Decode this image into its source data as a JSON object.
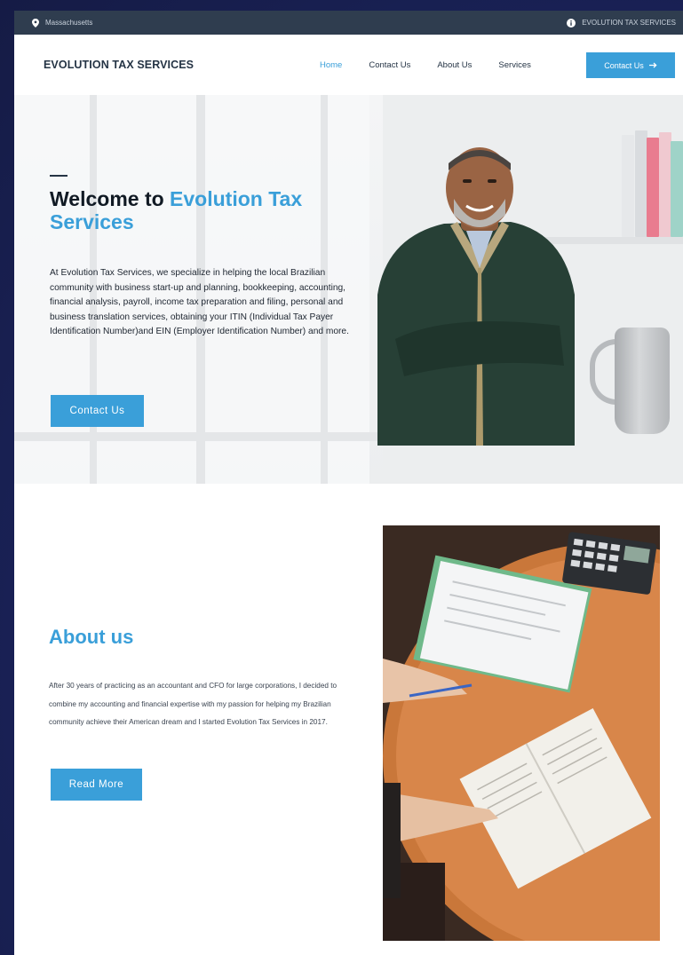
{
  "topbar": {
    "location": "Massachusetts",
    "location_icon": "map-pin-icon",
    "company": "EVOLUTION TAX SERVICES",
    "company_icon": "info-icon"
  },
  "header": {
    "logo": "EVOLUTION TAX SERVICES",
    "nav": [
      {
        "label": "Home",
        "active": true
      },
      {
        "label": "Contact Us",
        "active": false
      },
      {
        "label": "About Us",
        "active": false
      },
      {
        "label": "Services",
        "active": false
      }
    ],
    "cta_label": "Contact Us",
    "cta_icon": "arrow-right-icon"
  },
  "hero": {
    "title_prefix": "Welcome to ",
    "title_accent": "Evolution Tax Services",
    "body": "At Evolution Tax Services, we specialize in helping the local Brazilian community with business start-up and planning, bookkeeping, accounting, financial analysis, payroll, income tax preparation and filing, personal and business translation services, obtaining your ITIN (Individual Tax Payer Identification Number)and EIN (Employer Identification Number) and more.",
    "button_label": "Contact Us"
  },
  "about": {
    "title": "About us",
    "body": "After 30 years of practicing as an accountant and CFO for large corporations, I decided to combine my accounting and financial expertise with my passion for helping my Brazilian community achieve their American dream and I started Evolution Tax Services in 2017.",
    "button_label": "Read More"
  },
  "colors": {
    "accent": "#3a9fd9",
    "topbar": "#2f3d4f",
    "heading": "#111a24"
  }
}
